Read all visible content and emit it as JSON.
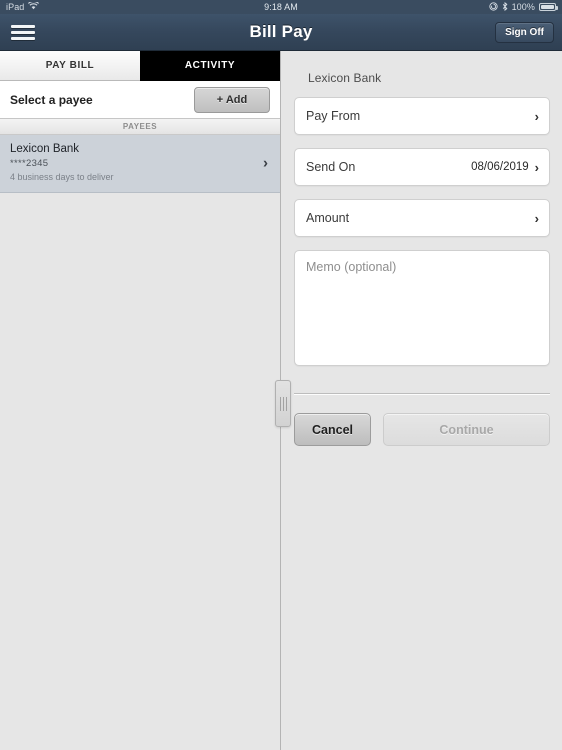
{
  "status_bar": {
    "device": "iPad",
    "wifi_icon": "wifi-icon",
    "time": "9:18 AM",
    "rotation_lock_icon": "rotation-lock-icon",
    "bluetooth_icon": "bluetooth-icon",
    "battery_percent": "100%",
    "battery_icon": "battery-icon"
  },
  "nav": {
    "menu_icon": "hamburger-menu-icon",
    "title": "Bill Pay",
    "sign_off_label": "Sign Off"
  },
  "tabs": [
    {
      "label": "PAY BILL",
      "selected": true
    },
    {
      "label": "ACTIVITY",
      "selected": false
    }
  ],
  "left_panel": {
    "select_payee_label": "Select a payee",
    "add_button_label": "+ Add",
    "section_header": "PAYEES",
    "payees": [
      {
        "name": "Lexicon Bank",
        "account": "****2345",
        "note": "4 business days to deliver",
        "chevron": "›",
        "selected": true
      }
    ]
  },
  "divider": {
    "handle_icon": "drag-handle-icon"
  },
  "right_panel": {
    "detail_title": "Lexicon Bank",
    "fields": [
      {
        "label": "Pay From",
        "value": "",
        "chevron": "›"
      },
      {
        "label": "Send On",
        "value": "08/06/2019",
        "chevron": "›"
      },
      {
        "label": "Amount",
        "value": "",
        "chevron": "›"
      }
    ],
    "memo_placeholder": "Memo (optional)",
    "memo_value": "",
    "cancel_label": "Cancel",
    "continue_label": "Continue",
    "continue_enabled": false
  },
  "colors": {
    "nav_bar": "#35475c",
    "tab_selected_bg": "#f1f1f1",
    "tab_unselected_bg": "#000000",
    "payee_selected_bg": "#ccd2d9",
    "panel_bg": "#e6e6e6",
    "field_bg": "#ffffff"
  }
}
